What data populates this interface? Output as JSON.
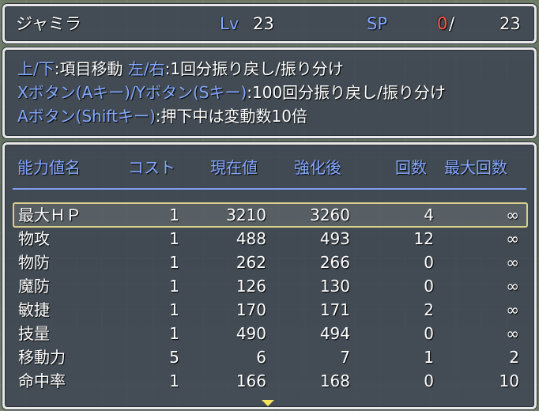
{
  "header": {
    "name": "ジャミラ",
    "lv_label": "Lv",
    "lv_value": "23",
    "sp_label": "SP",
    "sp_current": "0",
    "sp_sep": "/",
    "sp_max": "23"
  },
  "help": {
    "line1_key": "上/下",
    "line1_text1": ":項目移動 ",
    "line1_key2": "左/右",
    "line1_text2": ":1回分振り戻し/振り分け",
    "line2_key": "Xボタン(Aキー)/Yボタン(Sキー)",
    "line2_text": ":100回分振り戻し/振り分け",
    "line3_key": "Aボタン(Shiftキー)",
    "line3_text": ":押下中は変動数10倍"
  },
  "columns": {
    "name": "能力値名",
    "cost": "コスト",
    "current": "現在値",
    "after": "強化後",
    "count": "回数",
    "max": "最大回数"
  },
  "rows": [
    {
      "name": "最大ＨＰ",
      "cost": "1",
      "current": "3210",
      "after": "3260",
      "count": "4",
      "max": "∞"
    },
    {
      "name": "物攻",
      "cost": "1",
      "current": "488",
      "after": "493",
      "count": "12",
      "max": "∞"
    },
    {
      "name": "物防",
      "cost": "1",
      "current": "262",
      "after": "266",
      "count": "0",
      "max": "∞"
    },
    {
      "name": "魔防",
      "cost": "1",
      "current": "126",
      "after": "130",
      "count": "0",
      "max": "∞"
    },
    {
      "name": "敏捷",
      "cost": "1",
      "current": "170",
      "after": "171",
      "count": "2",
      "max": "∞"
    },
    {
      "name": "技量",
      "cost": "1",
      "current": "490",
      "after": "494",
      "count": "0",
      "max": "∞"
    },
    {
      "name": "移動力",
      "cost": "5",
      "current": "6",
      "after": "7",
      "count": "1",
      "max": "2"
    },
    {
      "name": "命中率",
      "cost": "1",
      "current": "166",
      "after": "168",
      "count": "0",
      "max": "10"
    }
  ],
  "colors": {
    "system": "#84a9ff",
    "crisis": "#ff5a4a",
    "cursor": "#d8d08a",
    "scroll_arrow": "#f4e45c"
  },
  "icons": {
    "scroll_down": "down-triangle"
  }
}
